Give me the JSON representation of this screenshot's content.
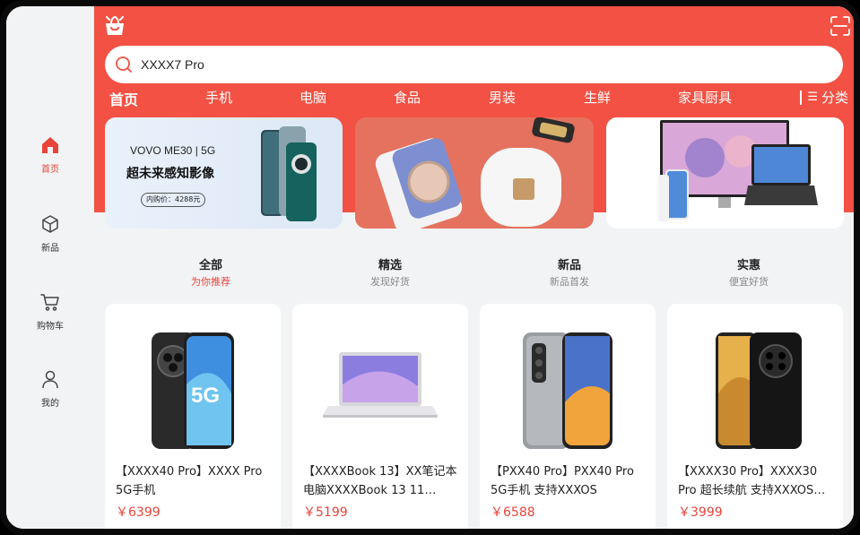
{
  "sidebar": {
    "items": [
      {
        "label": "首页",
        "icon": "home-icon",
        "active": true
      },
      {
        "label": "新品",
        "icon": "box-icon",
        "active": false
      },
      {
        "label": "购物车",
        "icon": "cart-icon",
        "active": false
      },
      {
        "label": "我的",
        "icon": "user-icon",
        "active": false
      }
    ]
  },
  "header": {
    "search_value": "XXXX7 Pro",
    "categories": [
      "首页",
      "手机",
      "电脑",
      "食品",
      "男装",
      "生鲜",
      "家具厨具"
    ],
    "more_label": "分类"
  },
  "banners": [
    {
      "brand": "VOVO  ME30 | 5G",
      "slogan": "超未来感知影像",
      "price_tag": "内购价：4288元"
    },
    {},
    {}
  ],
  "tabs": [
    {
      "title": "全部",
      "subtitle": "为你推荐",
      "active": true
    },
    {
      "title": "精选",
      "subtitle": "发现好货",
      "active": false
    },
    {
      "title": "新品",
      "subtitle": "新品首发",
      "active": false
    },
    {
      "title": "实惠",
      "subtitle": "便宜好货",
      "active": false
    }
  ],
  "products": [
    {
      "title": "【XXXX40 Pro】XXXX Pro 5G手机",
      "price": "￥6399"
    },
    {
      "title": "【XXXXBook 13】XX笔记本电脑XXXXBook 13 11…",
      "price": "￥5199"
    },
    {
      "title": "【PXX40 Pro】PXX40 Pro 5G手机 支持XXXOS",
      "price": "￥6588"
    },
    {
      "title": "【XXXX30 Pro】XXXX30 Pro 超长续航 支持XXXOS…",
      "price": "￥3999"
    }
  ],
  "colors": {
    "accent": "#f25143",
    "price": "#e8443a"
  }
}
